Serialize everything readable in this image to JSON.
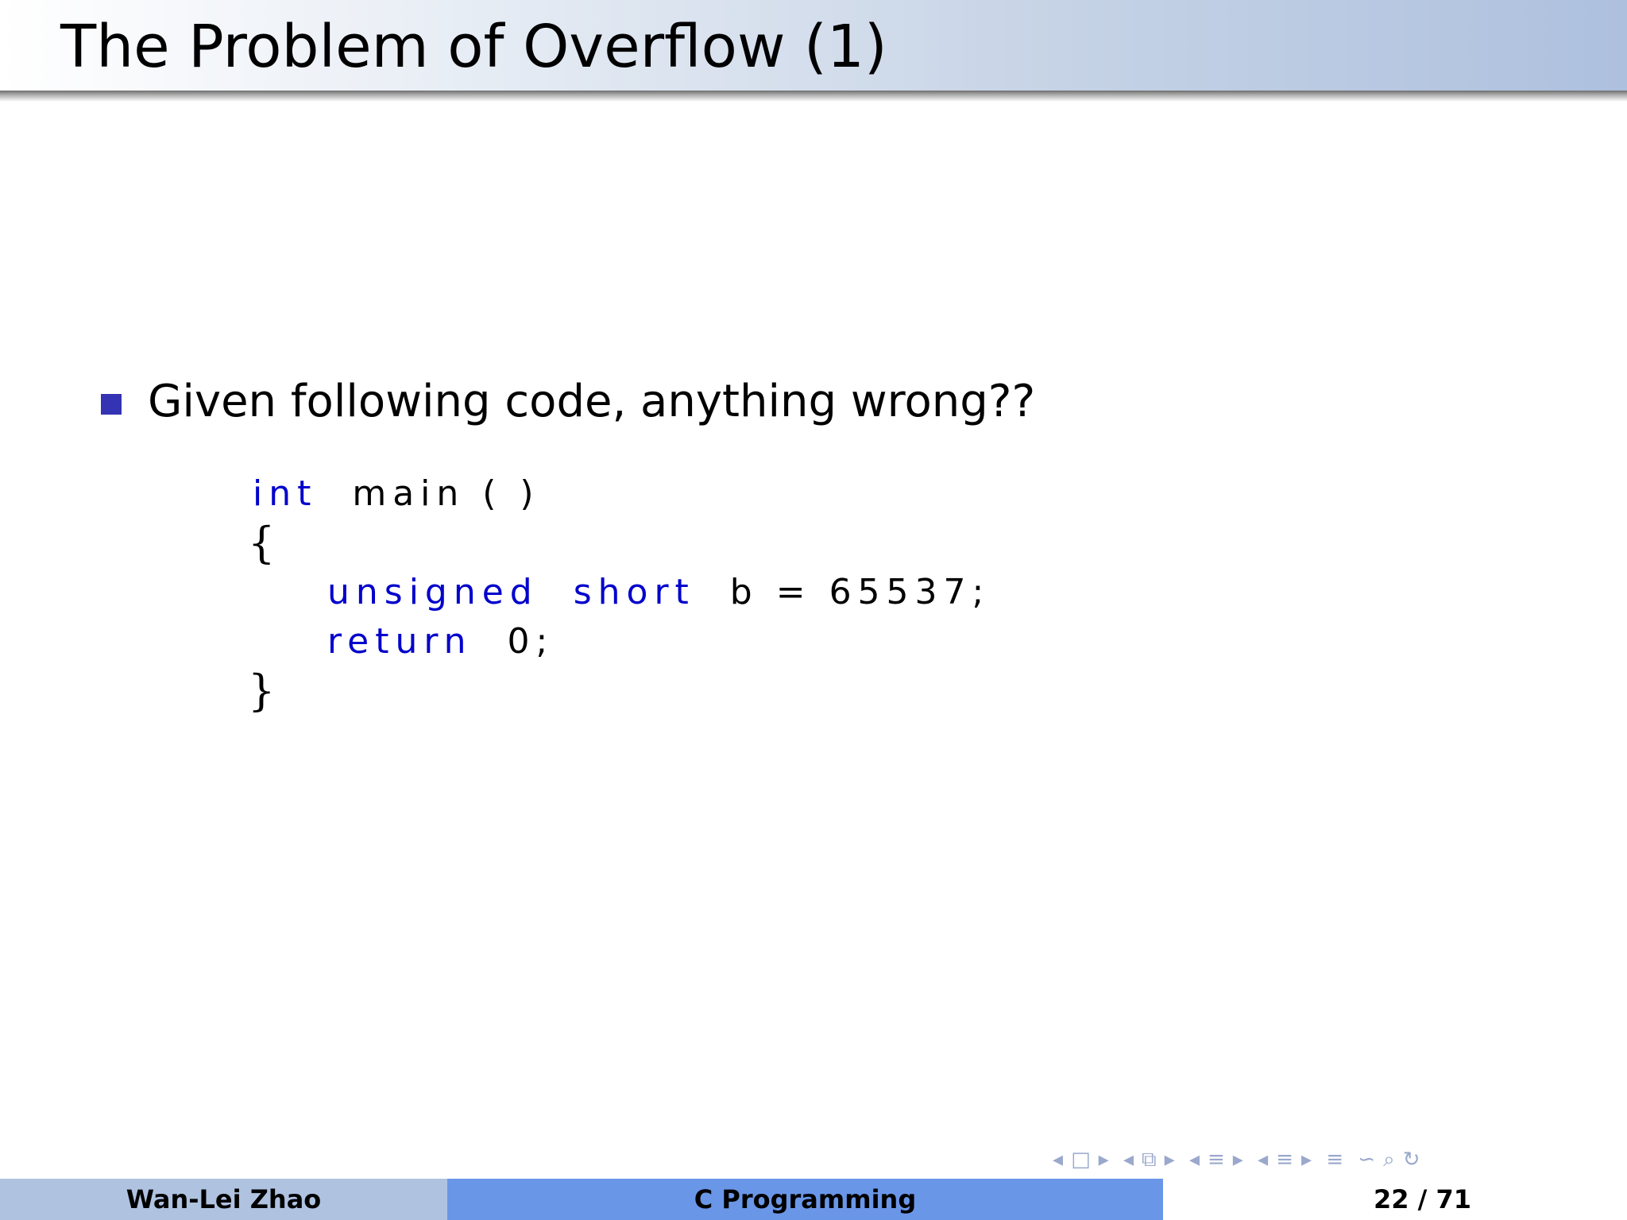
{
  "slide": {
    "title": "The Problem of Overflow (1)",
    "bullet": "Given following code, anything wrong??"
  },
  "code": {
    "line1_kw": "int",
    "line1_rest": "main ( )",
    "open_brace": "{",
    "line3_kw1": "unsigned",
    "line3_kw2": "short",
    "line3_rest": "b = 65537;",
    "line4_kw": "return",
    "line4_rest": "0;",
    "close_brace": "}"
  },
  "nav": {
    "icons": [
      "◂",
      "□",
      "▸",
      "◂",
      "⧉",
      "▸",
      "◂",
      "≡",
      "▸",
      "◂",
      "≡",
      "▸",
      "≡",
      "∽",
      "⌕",
      "↻"
    ]
  },
  "footer": {
    "author": "Wan-Lei Zhao",
    "course": "C Programming",
    "page_current": "22",
    "page_sep": "/",
    "page_total": "71"
  }
}
